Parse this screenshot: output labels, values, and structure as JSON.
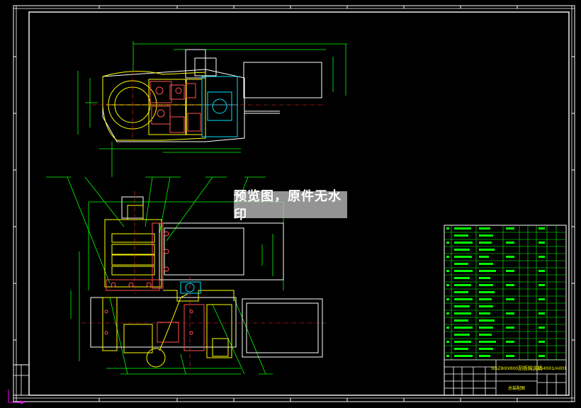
{
  "watermark": {
    "text": "预览图，原件无水印"
  },
  "title_block": {
    "drawing_name": "SGZ800/800刮板输送机",
    "drawing_number": "1S4S01/A001",
    "label": "总装配图"
  },
  "colors": {
    "background": "#000000",
    "frame": "#ffffff",
    "primary_lines": "#ffff00",
    "dimensions": "#00ff00",
    "parts": "#ff5050",
    "centerlines": "#ff3030",
    "reducer": "#00e0ff",
    "table": "#00ff00",
    "watermark_bg": "#bebebe"
  }
}
